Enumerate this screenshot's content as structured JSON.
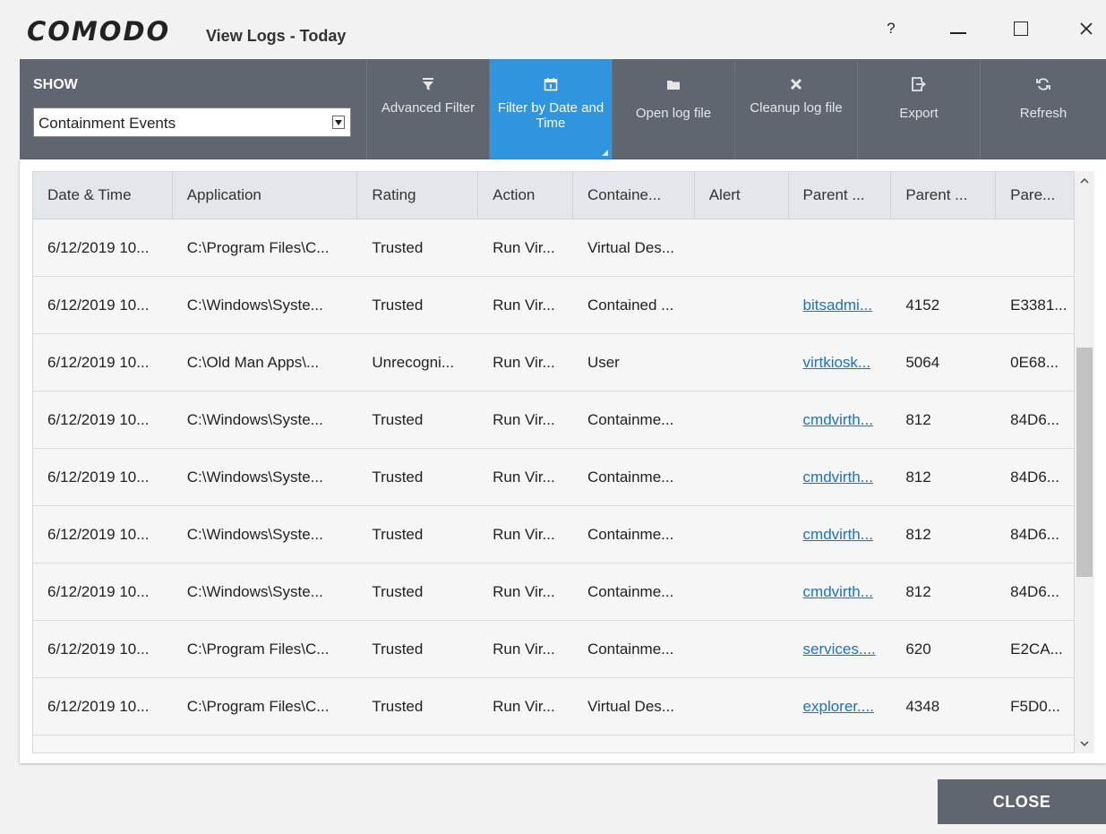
{
  "window": {
    "brand": "COMODO",
    "title": "View Logs - Today",
    "help_glyph": "?"
  },
  "toolbar": {
    "show_label": "SHOW",
    "show_value": "Containment Events",
    "buttons": [
      {
        "label": "Advanced Filter",
        "icon": "filter-icon"
      },
      {
        "label": "Filter by Date and Time",
        "icon": "calendar-icon",
        "active": true
      },
      {
        "label": "Open log file",
        "icon": "folder-icon"
      },
      {
        "label": "Cleanup log file",
        "icon": "cleanup-icon"
      },
      {
        "label": "Export",
        "icon": "export-icon"
      },
      {
        "label": "Refresh",
        "icon": "refresh-icon"
      }
    ]
  },
  "table": {
    "columns": [
      "Date & Time",
      "Application",
      "Rating",
      "Action",
      "Containe...",
      "Alert",
      "Parent ...",
      "Parent ...",
      "Pare..."
    ],
    "rows": [
      [
        "6/12/2019 10...",
        "C:\\Program Files\\C...",
        "Trusted",
        "Run Vir...",
        "Virtual Des...",
        "",
        "",
        "",
        ""
      ],
      [
        "6/12/2019 10...",
        "C:\\Windows\\Syste...",
        "Trusted",
        "Run Vir...",
        "Contained ...",
        "",
        "bitsadmi...",
        "4152",
        "E3381..."
      ],
      [
        "6/12/2019 10...",
        "C:\\Old Man Apps\\...",
        "Unrecogni...",
        "Run Vir...",
        "User",
        "",
        "virtkiosk...",
        "5064",
        "0E68..."
      ],
      [
        "6/12/2019 10...",
        "C:\\Windows\\Syste...",
        "Trusted",
        "Run Vir...",
        "Containme...",
        "",
        "cmdvirth...",
        "812",
        "84D6..."
      ],
      [
        "6/12/2019 10...",
        "C:\\Windows\\Syste...",
        "Trusted",
        "Run Vir...",
        "Containme...",
        "",
        "cmdvirth...",
        "812",
        "84D6..."
      ],
      [
        "6/12/2019 10...",
        "C:\\Windows\\Syste...",
        "Trusted",
        "Run Vir...",
        "Containme...",
        "",
        "cmdvirth...",
        "812",
        "84D6..."
      ],
      [
        "6/12/2019 10...",
        "C:\\Windows\\Syste...",
        "Trusted",
        "Run Vir...",
        "Containme...",
        "",
        "cmdvirth...",
        "812",
        "84D6..."
      ],
      [
        "6/12/2019 10...",
        "C:\\Program Files\\C...",
        "Trusted",
        "Run Vir...",
        "Containme...",
        "",
        "services....",
        "620",
        "E2CA..."
      ],
      [
        "6/12/2019 10...",
        "C:\\Program Files\\C...",
        "Trusted",
        "Run Vir...",
        "Virtual Des...",
        "",
        "explorer....",
        "4348",
        "F5D0..."
      ]
    ]
  },
  "footer": {
    "close_label": "CLOSE"
  },
  "colors": {
    "toolbar_bg": "#5f6670",
    "active_button": "#2f95de",
    "link": "#1a73c7"
  }
}
